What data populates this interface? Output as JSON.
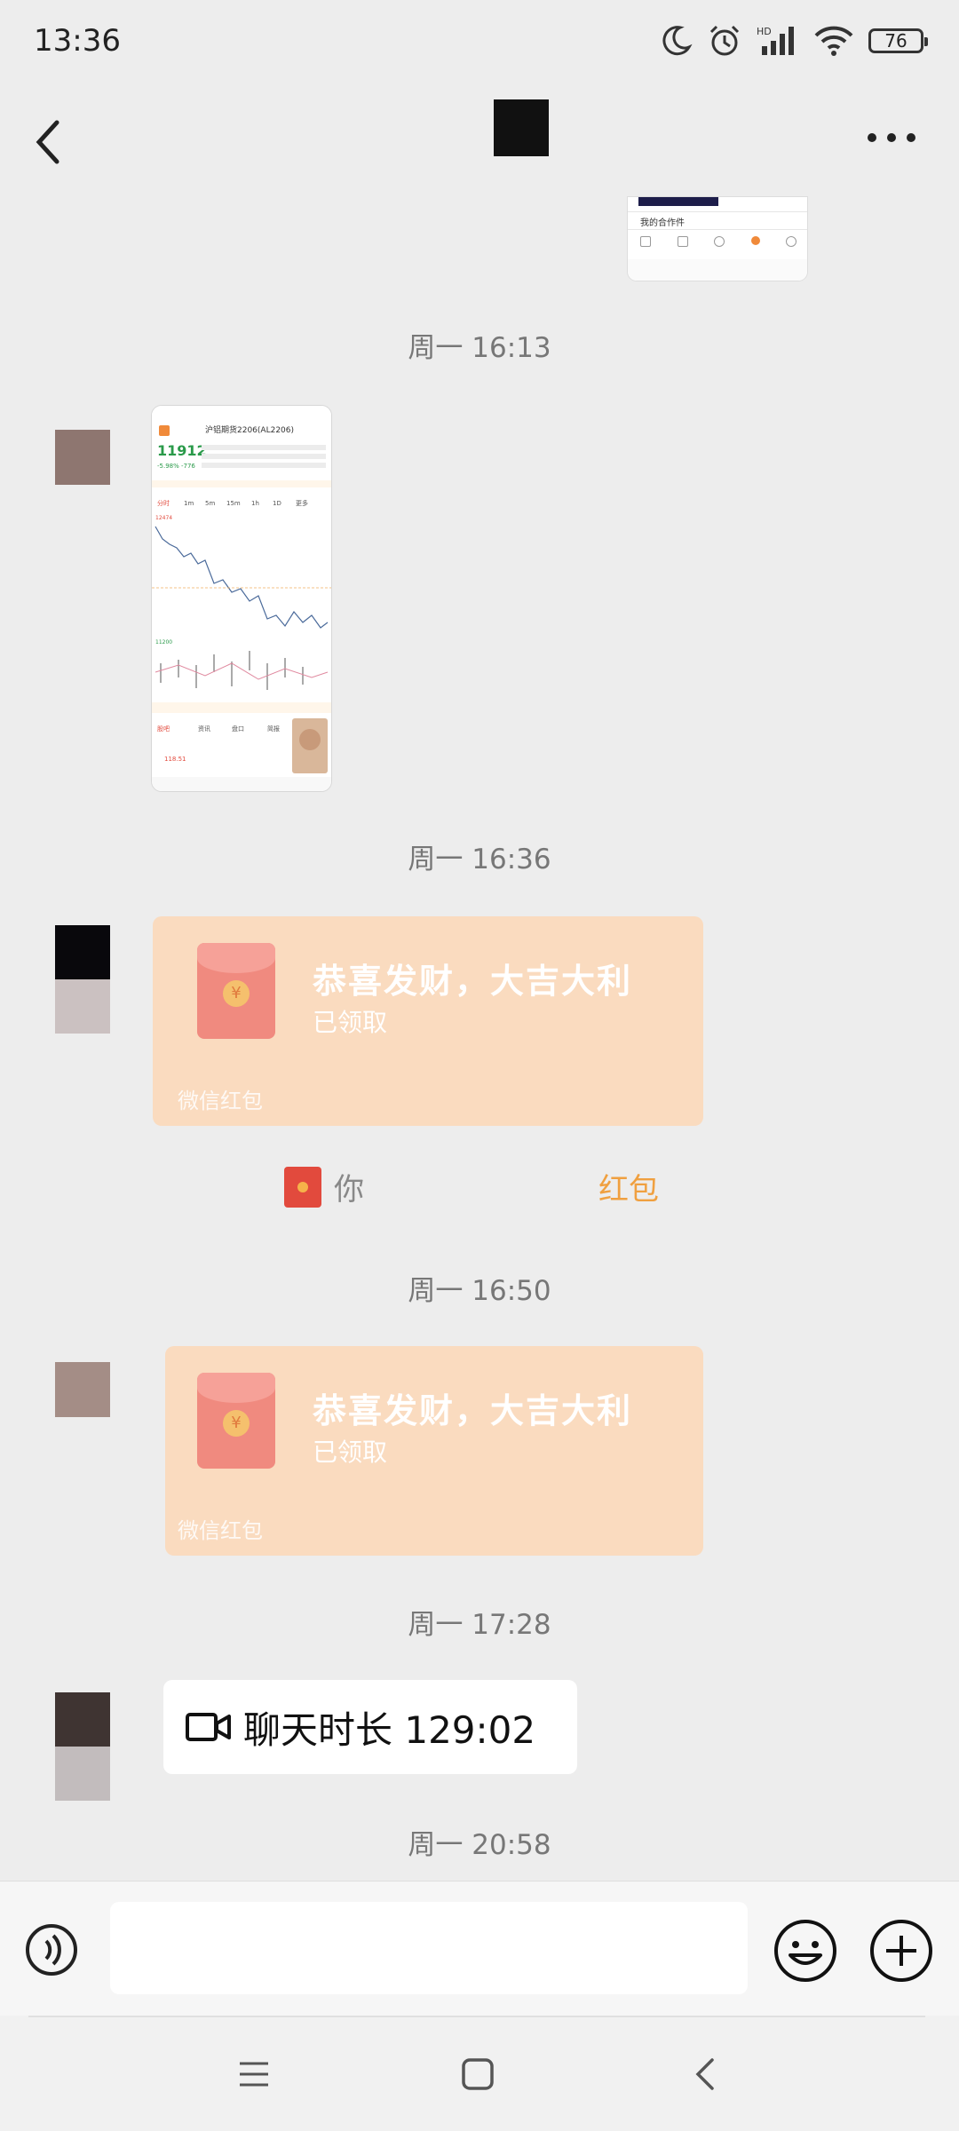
{
  "status_bar": {
    "time": "13:36",
    "battery": "76",
    "network": "HD"
  },
  "header": {
    "back_icon": "chevron-left-icon",
    "more_icon": "more-dots-icon"
  },
  "timestamps": [
    "周一 16:13",
    "周一 16:36",
    "周一 16:50",
    "周一 17:28",
    "周一 20:58"
  ],
  "screenshot_thumb": {
    "top_menu_item": "我的合作件",
    "stock_code": "沪铝期货2206(AL2206)",
    "price": "11912",
    "change": "-5.98% -776",
    "tabs": [
      "分时",
      "1m",
      "5m",
      "15m",
      "1h",
      "1D",
      "更多"
    ],
    "axis_high": "12474",
    "axis_low": "11200",
    "bottom_tabs": [
      "股吧",
      "资讯",
      "盘口",
      "简报"
    ],
    "quote": "118.51"
  },
  "red_packets": [
    {
      "title": "恭喜发财，大吉大利",
      "status": "已领取",
      "footer": "微信红包"
    },
    {
      "title": "恭喜发财，大吉大利",
      "status": "已领取",
      "footer": "微信红包"
    }
  ],
  "system_notice": {
    "prefix": "你",
    "suffix": "红包"
  },
  "call": {
    "text": "聊天时长 129:02",
    "icon": "video-call-icon"
  },
  "input": {
    "placeholder": "",
    "value": ""
  },
  "nav": {
    "menu_icon": "menu-icon",
    "home_icon": "home-icon",
    "back_icon": "back-icon"
  },
  "colors": {
    "background": "#ededed",
    "red_packet": "#fadbbf",
    "accent_orange": "#f0a040",
    "red_icon": "#e24a3d"
  }
}
